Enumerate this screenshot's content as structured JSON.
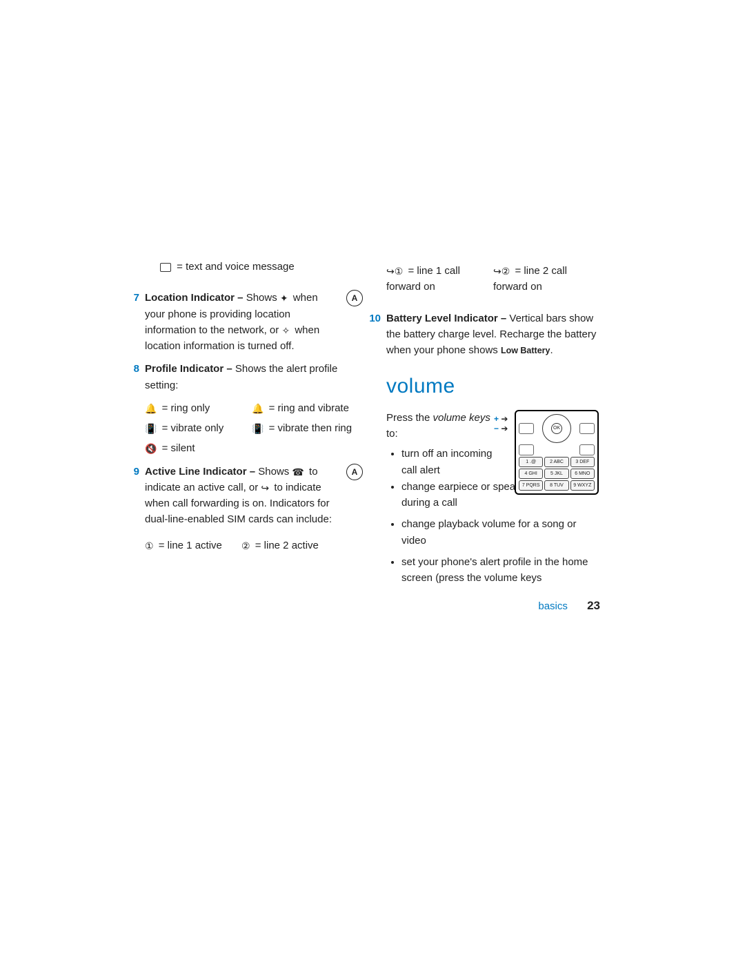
{
  "left": {
    "text_voice": "= text and voice message",
    "item7": {
      "num": "7",
      "title": "Location Indicator –",
      "body_a": "Shows ",
      "body_b": " when your phone is providing location information to the network, or ",
      "body_c": " when location information is turned off."
    },
    "item8": {
      "num": "8",
      "title": "Profile Indicator –",
      "body": "Shows the alert profile setting:",
      "ring_only": "= ring only",
      "ring_vibrate": "= ring and vibrate",
      "vibrate_only": "= vibrate only",
      "vibrate_ring": "= vibrate then ring",
      "silent": "= silent"
    },
    "item9": {
      "num": "9",
      "title": "Active Line Indicator –",
      "body_a": "Shows ",
      "body_b": " to indicate an active call, or ",
      "body_c": " to indicate when call forwarding is on. Indicators for dual-line-enabled SIM cards can include:",
      "l1a": "= line 1 active",
      "l2a": "= line 2 active"
    }
  },
  "right": {
    "fwd1": "= line 1 call forward on",
    "fwd2": "= line 2 call forward on",
    "item10": {
      "num": "10",
      "title": "Battery Level Indicator –",
      "body": "Vertical bars show the battery charge level. Recharge the battery when your phone shows ",
      "low": "Low Battery",
      "dot": "."
    },
    "volume_h": "volume",
    "vol_intro_a": "Press the ",
    "vol_intro_b": "volume keys",
    "vol_intro_c": " to:",
    "bullets": [
      "turn off an incoming call alert",
      "change earpiece or speakerphone volume during a call",
      "change playback volume for a song or video",
      "set your phone's alert profile in the home screen (press the volume keys"
    ],
    "keys": {
      "r1": [
        "1 .@",
        "2 ABC",
        "3 DEF"
      ],
      "r2": [
        "4 GHI",
        "5 JKL",
        "6 MNO"
      ],
      "r3": [
        "7 PQRS",
        "8 TUV",
        "9 WXYZ"
      ]
    }
  },
  "footer": {
    "section": "basics",
    "page": "23"
  }
}
